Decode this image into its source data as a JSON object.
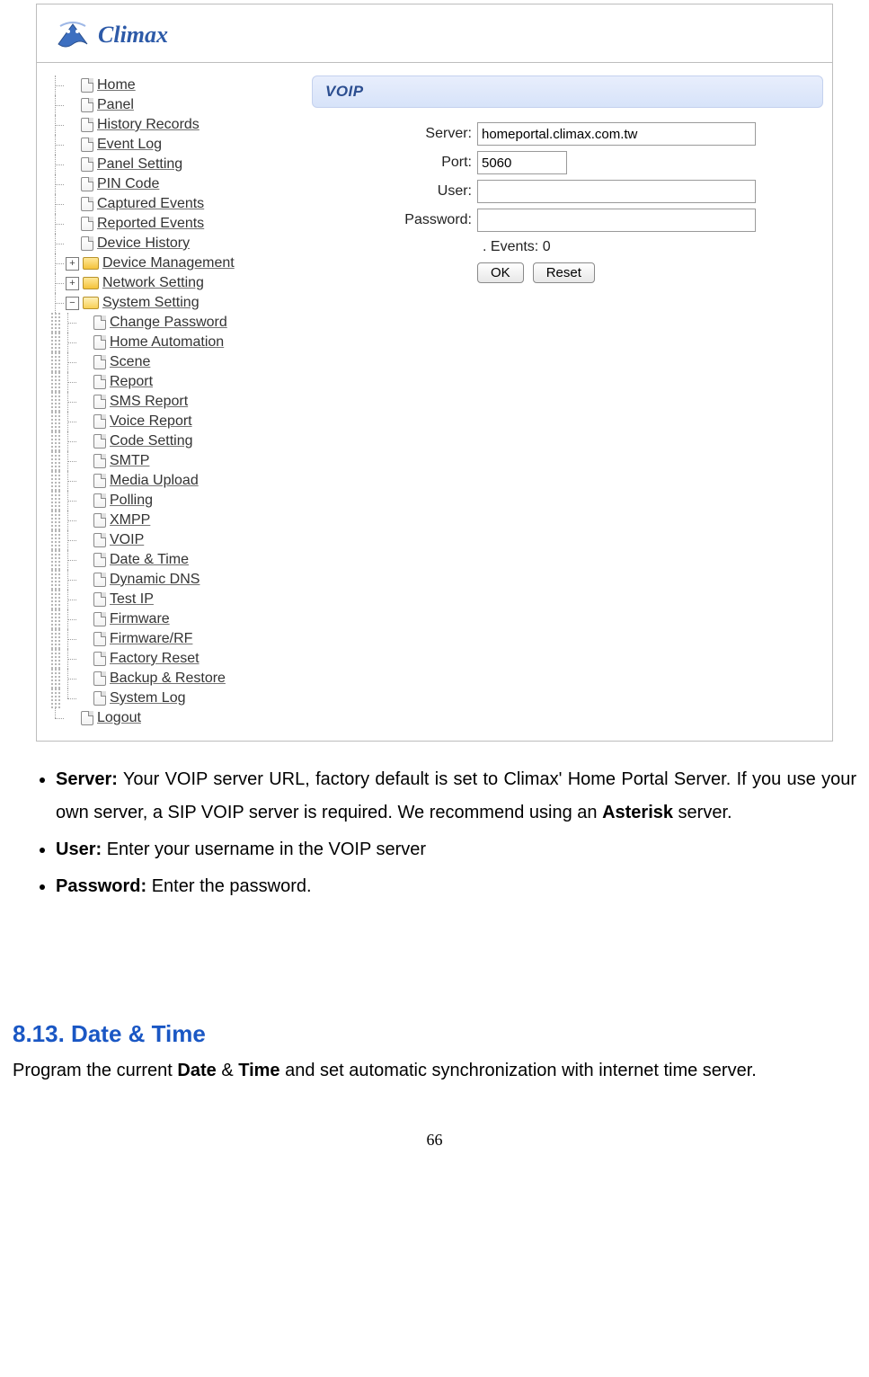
{
  "logo": {
    "brand": "Climax"
  },
  "tree": {
    "top": [
      "Home",
      "Panel",
      "History Records",
      "Event Log",
      "Panel Setting",
      "PIN Code",
      "Captured Events",
      "Reported Events",
      "Device History"
    ],
    "device_mgmt": "Device Management",
    "network_setting": "Network Setting",
    "system_setting": "System Setting",
    "system_children": [
      "Change Password",
      "Home Automation",
      "Scene",
      "Report",
      "SMS Report",
      "Voice Report",
      "Code Setting",
      "SMTP",
      "Media Upload",
      "Polling",
      "XMPP",
      "VOIP",
      "Date & Time",
      "Dynamic DNS",
      "Test IP",
      "Firmware",
      "Firmware/RF",
      "Factory Reset",
      "Backup & Restore",
      "System Log"
    ],
    "logout": "Logout"
  },
  "panel": {
    "title": "VOIP",
    "labels": {
      "server": "Server:",
      "port": "Port:",
      "user": "User:",
      "password": "Password:"
    },
    "values": {
      "server": "homeportal.climax.com.tw",
      "port": "5060",
      "user": "",
      "password": ""
    },
    "events_text": ". Events: 0",
    "buttons": {
      "ok": "OK",
      "reset": "Reset"
    }
  },
  "doc": {
    "bullets": [
      {
        "label": "Server:",
        "text": " Your VOIP server URL, factory default is set to Climax' Home Portal Server. If you use your own server, a SIP VOIP server is required. We recommend using an ",
        "tail_bold": "Asterisk",
        "tail": " server."
      },
      {
        "label": "User:",
        "text": " Enter your username in the VOIP server"
      },
      {
        "label": "Password:",
        "text": " Enter the password."
      }
    ],
    "heading": "8.13. Date & Time",
    "body_pre": "Program the current ",
    "body_b1": "Date",
    "body_mid": " & ",
    "body_b2": "Time",
    "body_post": " and set automatic synchronization with internet time server.",
    "page_number": "66"
  }
}
